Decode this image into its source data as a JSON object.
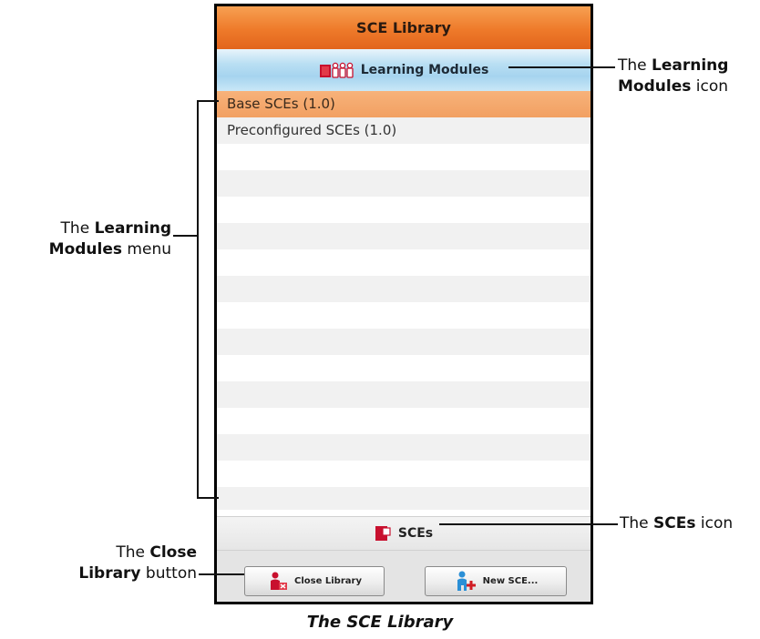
{
  "window": {
    "title": "SCE Library"
  },
  "modules_bar": {
    "label": "Learning Modules",
    "icon": "learning-modules-icon"
  },
  "list": {
    "items": [
      {
        "label": "Base SCEs (1.0)",
        "selected": true
      },
      {
        "label": "Preconfigured SCEs (1.0)",
        "selected": false
      }
    ]
  },
  "sces_bar": {
    "label": "SCEs",
    "icon": "sces-icon"
  },
  "footer": {
    "close_label": "Close Library",
    "new_label": "New SCE..."
  },
  "annotations": {
    "modules_icon_1": "The ",
    "modules_icon_bold_1": "Learning",
    "modules_icon_bold_2": "Modules",
    "modules_icon_2": " icon",
    "menu_1": "The ",
    "menu_bold_1": "Learning",
    "menu_bold_2": "Modules",
    "menu_2": " menu",
    "sces_1": "The ",
    "sces_bold": "SCEs",
    "sces_2": " icon",
    "close_1": "The ",
    "close_bold_1": "Close",
    "close_bold_2": "Library",
    "close_2": " button"
  },
  "caption": "The SCE Library",
  "colors": {
    "titlebar": "#ee7a2a",
    "modules_bar": "#b9dff3",
    "selected_row": "#f2a062",
    "icon_red": "#c8102e"
  }
}
